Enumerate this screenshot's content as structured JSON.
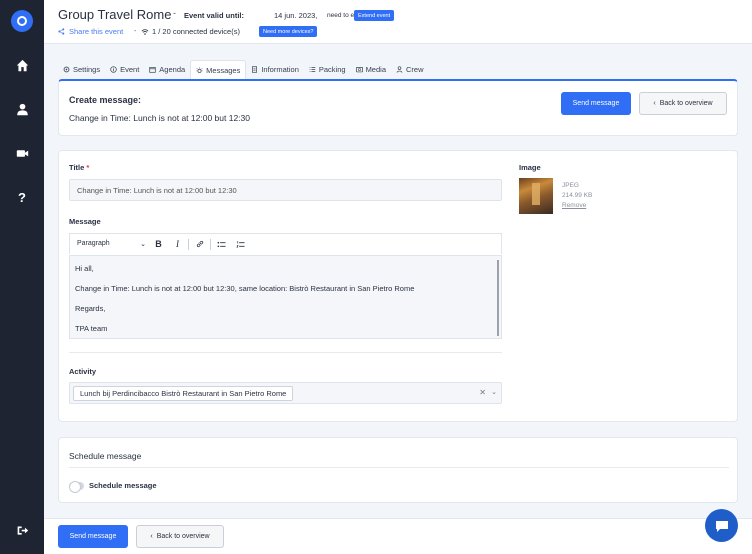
{
  "sidebar": {
    "icons": [
      "logo-icon",
      "home-icon",
      "user-icon",
      "video-icon",
      "help-icon",
      "logout-icon"
    ],
    "help_glyph": "?"
  },
  "header": {
    "title": "Group Travel Rome",
    "separator": "-",
    "valid_label": "Event valid until:",
    "valid_date": "14 jun. 2023,",
    "extend_question": "need to extend?",
    "extend_button": "Extend event",
    "share_label": "Share this event",
    "separator2": "-",
    "devices": "1 / 20 connected device(s)",
    "separator3": "-",
    "more_devices_button": "Need more devices?"
  },
  "tabs": [
    {
      "label": "Settings",
      "icon": "gear-icon"
    },
    {
      "label": "Event",
      "icon": "info-icon"
    },
    {
      "label": "Agenda",
      "icon": "calendar-icon"
    },
    {
      "label": "Messages",
      "icon": "bulb-icon",
      "active": true
    },
    {
      "label": "Information",
      "icon": "document-icon"
    },
    {
      "label": "Packing",
      "icon": "list-icon"
    },
    {
      "label": "Media",
      "icon": "media-icon"
    },
    {
      "label": "Crew",
      "icon": "person-icon"
    }
  ],
  "create": {
    "title": "Create message:",
    "subtitle": "Change in Time: Lunch is not at 12:00 but 12:30",
    "send_button": "Send message",
    "back_button": "Back to overview"
  },
  "form": {
    "title_label": "Title",
    "required_mark": "*",
    "title_value": "Change in Time: Lunch is not at 12:00 but 12:30",
    "message_label": "Message",
    "toolbar": {
      "paragraph": "Paragraph",
      "bold": "B",
      "italic": "I"
    },
    "message_lines": [
      "Hi all,",
      "Change in Time: Lunch is not at 12:00 but 12:30, same location: Bistrò Restaurant in San Pietro Rome",
      "Regards,",
      "TPA team"
    ],
    "activity_label": "Activity",
    "activity_value": "Lunch bij Perdincibacco Bistrò Restaurant in San Pietro Rome",
    "image_label": "Image",
    "image_type": "JPEG",
    "image_size": "214.99 KB",
    "image_remove": "Remove"
  },
  "schedule": {
    "title": "Schedule message",
    "toggle_label": "Schedule message",
    "enabled": false
  },
  "footer": {
    "send_button": "Send message",
    "back_button": "Back to overview"
  },
  "colors": {
    "primary": "#2f6ef5",
    "sidebar": "#1f2433",
    "required": "#e23b3b"
  }
}
